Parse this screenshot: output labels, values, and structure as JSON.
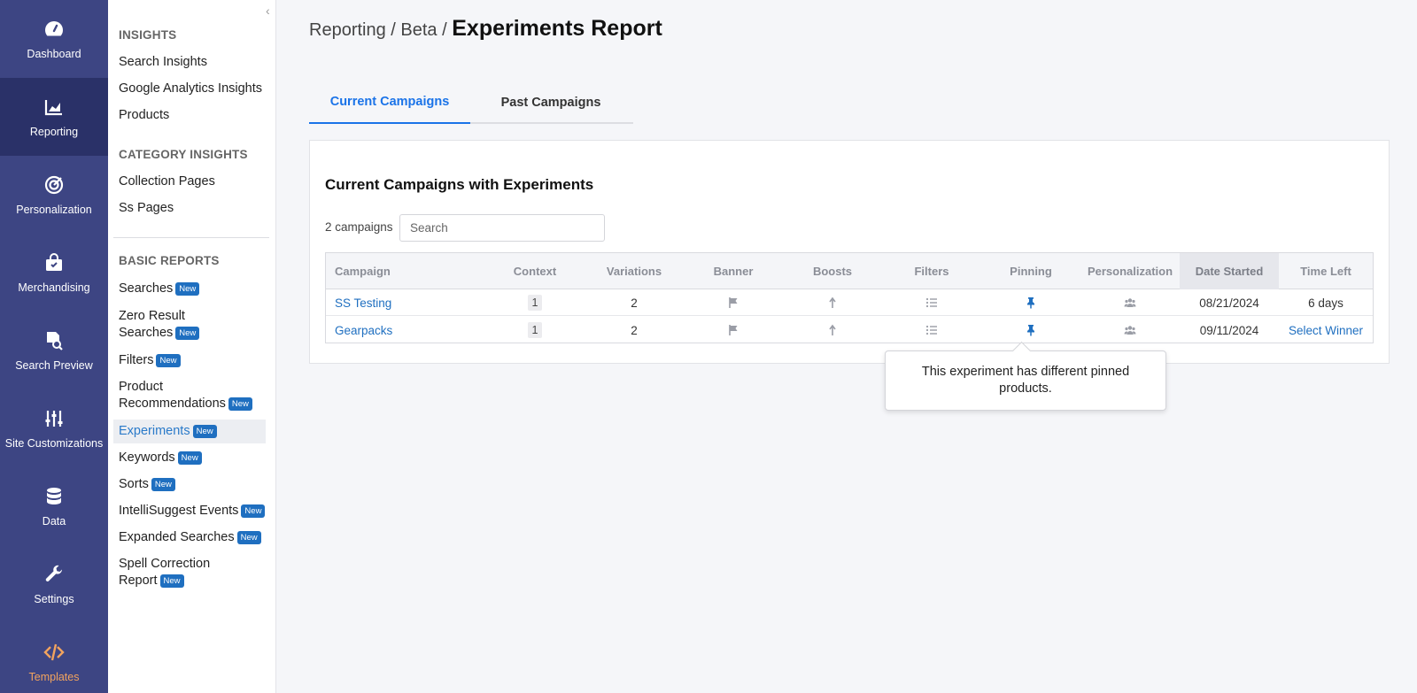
{
  "rail": [
    {
      "label": "Dashboard",
      "icon": "gauge-icon"
    },
    {
      "label": "Reporting",
      "icon": "chart-area-icon"
    },
    {
      "label": "Personalization",
      "icon": "target-icon"
    },
    {
      "label": "Merchandising",
      "icon": "shopping-bag-icon"
    },
    {
      "label": "Search Preview",
      "icon": "search-file-icon"
    },
    {
      "label": "Site Customizations",
      "icon": "sliders-icon"
    },
    {
      "label": "Data",
      "icon": "database-icon"
    },
    {
      "label": "Settings",
      "icon": "wrench-icon"
    },
    {
      "label": "Templates",
      "icon": "code-icon"
    }
  ],
  "subnav": {
    "insights_header": "INSIGHTS",
    "insights": [
      "Search Insights",
      "Google Analytics Insights",
      "Products"
    ],
    "category_header": "CATEGORY INSIGHTS",
    "category": [
      "Collection Pages",
      "Ss Pages"
    ],
    "basic_header": "BASIC REPORTS",
    "basic": [
      {
        "line1": "Searches",
        "line2": "",
        "badge": "New"
      },
      {
        "line1": "Zero Result",
        "line2": "Searches",
        "badge": "New"
      },
      {
        "line1": "Filters",
        "line2": "",
        "badge": "New"
      },
      {
        "line1": "Product",
        "line2": "Recommendations",
        "badge": "New"
      },
      {
        "line1": "Experiments",
        "line2": "",
        "badge": "New"
      },
      {
        "line1": "Keywords",
        "line2": "",
        "badge": "New"
      },
      {
        "line1": "Sorts",
        "line2": "",
        "badge": "New"
      },
      {
        "line1": "IntelliSuggest Events",
        "line2": "",
        "badge": "New"
      },
      {
        "line1": "Expanded Searches",
        "line2": "",
        "badge": "New"
      },
      {
        "line1": "Spell Correction",
        "line2": "Report",
        "badge": "New"
      }
    ]
  },
  "breadcrumb": {
    "part1": "Reporting",
    "sep": "/",
    "part2": "Beta",
    "current": "Experiments Report"
  },
  "tabs": [
    "Current Campaigns",
    "Past Campaigns"
  ],
  "card": {
    "title": "Current Campaigns with Experiments",
    "count": "2 campaigns",
    "search_placeholder": "Search"
  },
  "table": {
    "columns": [
      "Campaign",
      "Context",
      "Variations",
      "Banner",
      "Boosts",
      "Filters",
      "Pinning",
      "Personalization",
      "Date Started",
      "Time Left"
    ],
    "rows": [
      {
        "campaign": "SS Testing",
        "context": "1",
        "variations": "2",
        "date": "08/21/2024",
        "time_left": "6 days"
      },
      {
        "campaign": "Gearpacks",
        "context": "1",
        "variations": "2",
        "date": "09/11/2024",
        "time_left": "Select Winner"
      }
    ]
  },
  "tooltip": "This experiment has different pinned products.",
  "colors": {
    "rail": "#3d4583",
    "rail_active": "#2a3168",
    "accent": "#1a73e8",
    "link": "#1f6fc0",
    "badge": "#1f6fc0",
    "templates": "#f2a35e"
  }
}
